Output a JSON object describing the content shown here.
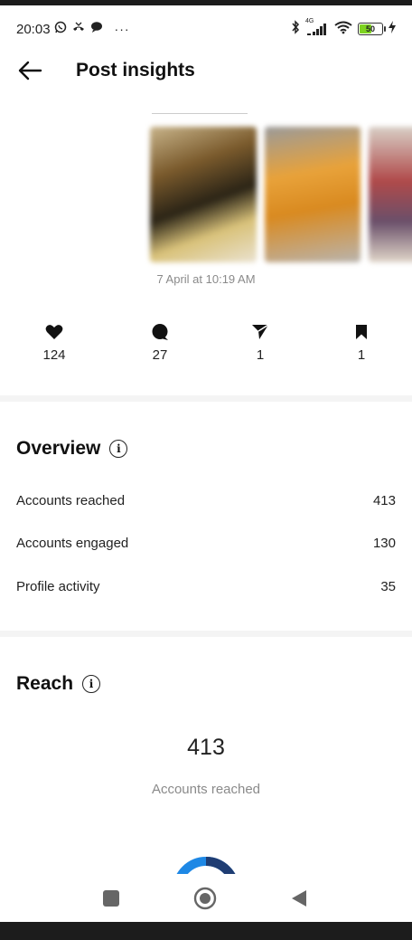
{
  "status_bar": {
    "time": "20:03",
    "left_icons": [
      "whatsapp-icon",
      "missed-call-icon",
      "chat-bubble-icon",
      "more-dots-icon"
    ],
    "more_label": "···",
    "network": "4G",
    "battery_level": "50",
    "right_icons": [
      "bluetooth-icon",
      "signal-icon",
      "wifi-icon",
      "battery-icon",
      "charging-icon"
    ]
  },
  "header": {
    "title": "Post insights",
    "back_icon": "arrow-left-icon"
  },
  "post": {
    "date": "7 April at 10:19 AM"
  },
  "stats": [
    {
      "icon": "heart-icon",
      "value": "124"
    },
    {
      "icon": "comment-icon",
      "value": "27"
    },
    {
      "icon": "share-icon",
      "value": "1"
    },
    {
      "icon": "bookmark-icon",
      "value": "1"
    }
  ],
  "overview": {
    "title": "Overview",
    "rows": [
      {
        "label": "Accounts reached",
        "value": "413"
      },
      {
        "label": "Accounts engaged",
        "value": "130"
      },
      {
        "label": "Profile activity",
        "value": "35"
      }
    ]
  },
  "reach": {
    "title": "Reach",
    "number": "413",
    "label": "Accounts reached"
  },
  "colors": {
    "donut_primary": "#1e88e5",
    "donut_secondary": "#1f3d73",
    "muted_text": "#8a8a8a"
  },
  "nav": [
    "recent-apps-icon",
    "home-icon",
    "back-triangle-icon"
  ]
}
